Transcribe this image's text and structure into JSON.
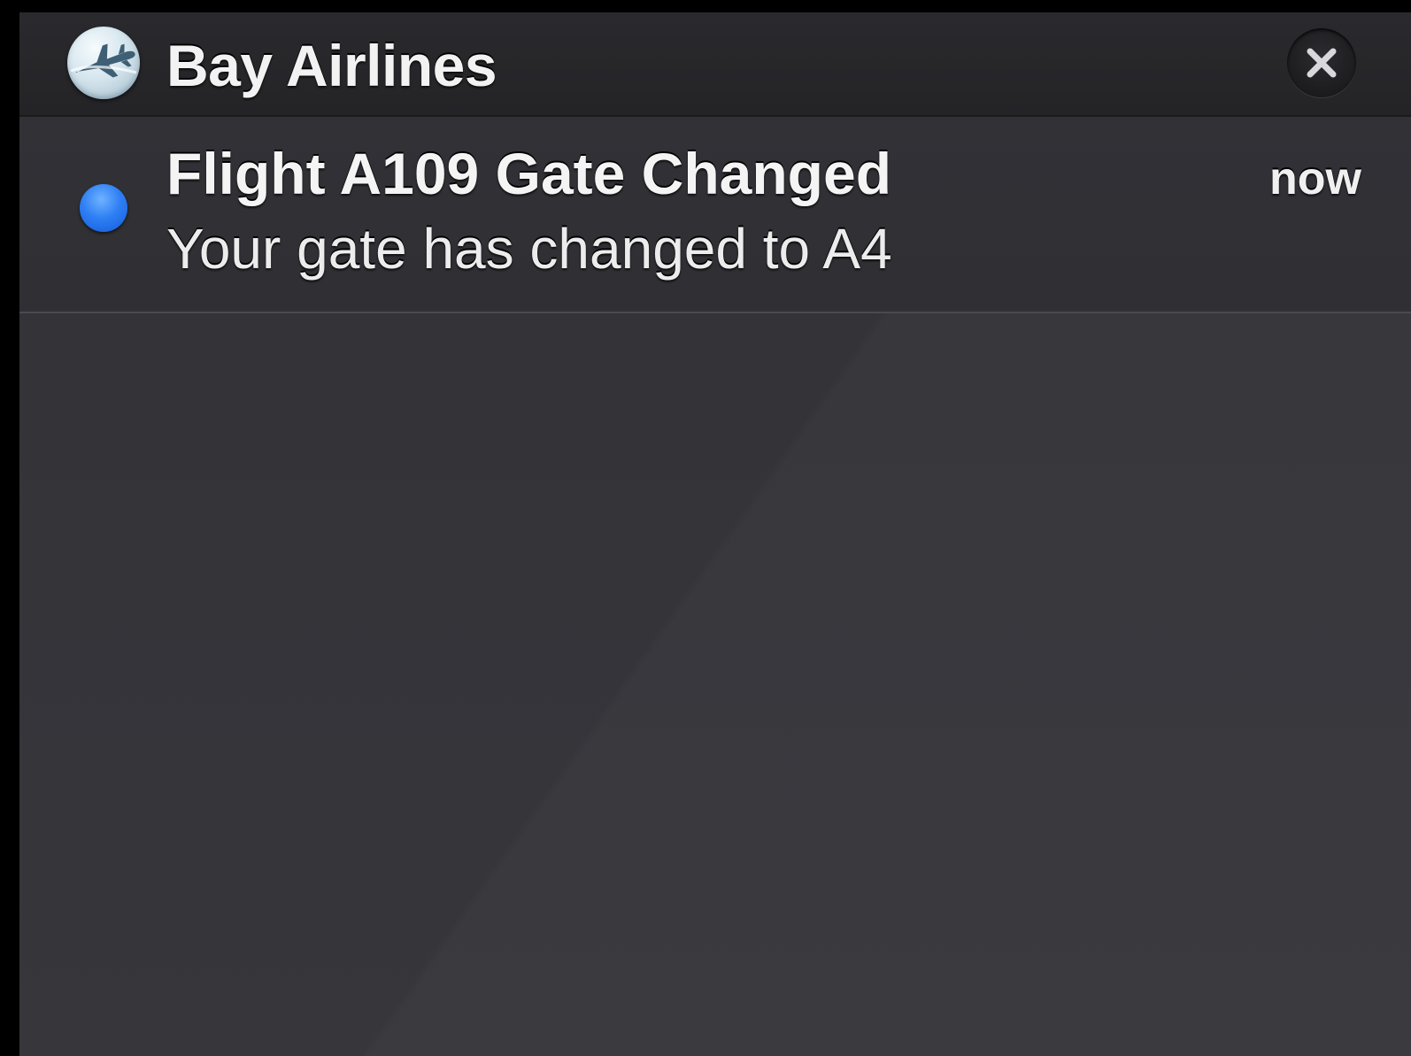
{
  "notification_center": {
    "app": {
      "name": "Bay Airlines",
      "icon": "airplane-icon"
    },
    "close_icon": "close-icon",
    "notifications": [
      {
        "title": "Flight A109 Gate Changed",
        "body": "Your gate has changed to A4",
        "time": "now",
        "unread": true
      }
    ]
  },
  "colors": {
    "background": "#000000",
    "panel": "#333338",
    "header": "#242427",
    "text": "#f2f2f2",
    "unread_dot": "#2f80f4"
  }
}
